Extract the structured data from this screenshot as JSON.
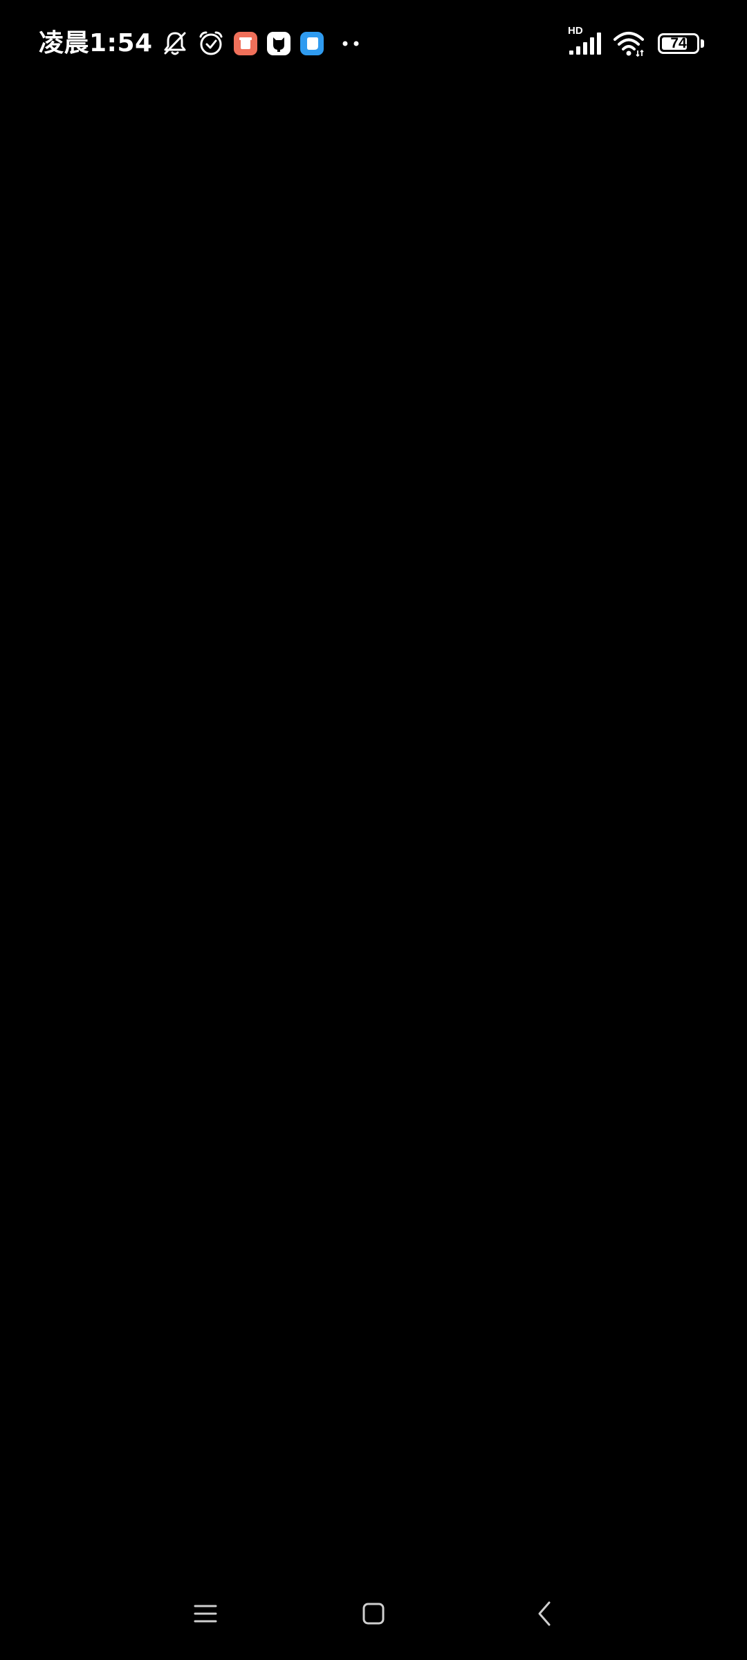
{
  "status_bar": {
    "time": "凌晨1:54",
    "icons_left": [
      "bell-off-icon",
      "alarm-clock-icon",
      "red-app-icon",
      "github-app-icon",
      "blue-app-icon",
      "more-dots-icon"
    ],
    "network_label": "HD",
    "battery_level": "74",
    "battery_fraction": 0.74
  },
  "nav_bar": {
    "buttons": [
      "menu-icon",
      "home-square-icon",
      "back-chevron-icon"
    ]
  },
  "colors": {
    "background": "#000000",
    "foreground": "#ffffff",
    "red_app": "#f0705a",
    "blue_app": "#2f9bf0"
  }
}
